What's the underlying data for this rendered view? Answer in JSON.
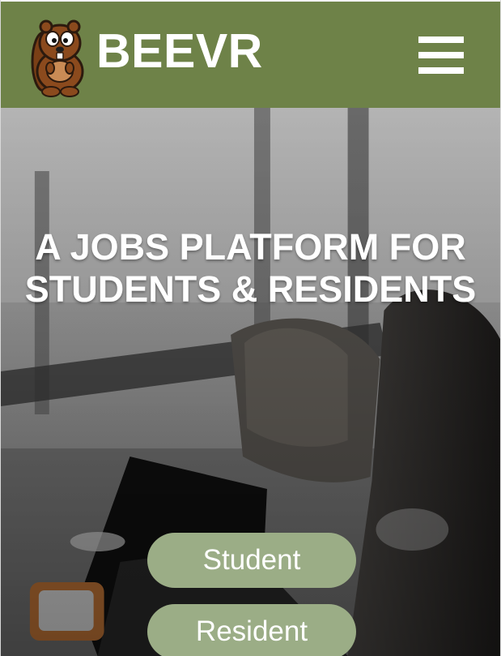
{
  "header": {
    "brand": "BEEVR",
    "logo_icon": "beaver-mascot-icon",
    "menu_icon": "hamburger-menu-icon",
    "background_color": "#6e8248"
  },
  "hero": {
    "headline_line1": "A JOBS PLATFORM FOR",
    "headline_line2": "STUDENTS & RESIDENTS",
    "background": "workspace-photo-with-laptop-and-bag"
  },
  "actions": {
    "student_label": "Student",
    "resident_label": "Resident",
    "button_color": "#9bad86"
  }
}
